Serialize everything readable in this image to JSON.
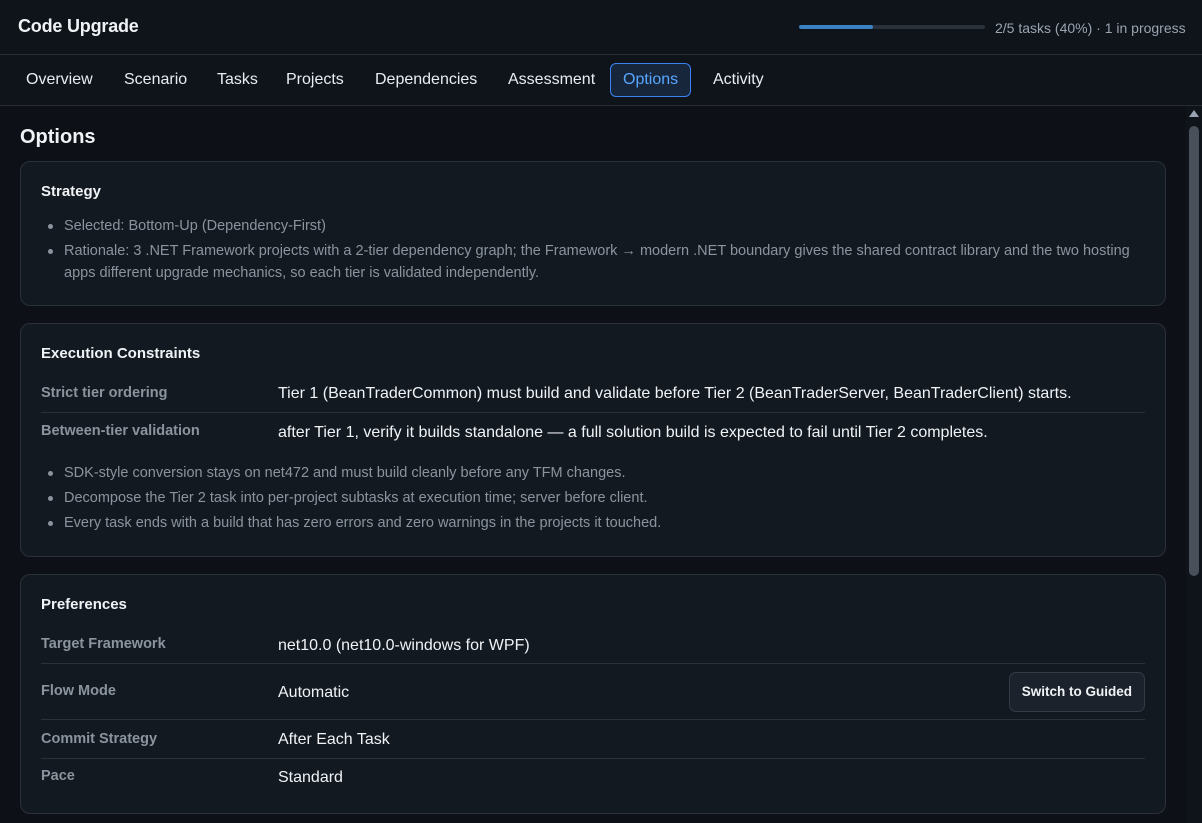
{
  "app": {
    "title": "Code Upgrade"
  },
  "progress": {
    "fraction": 0.4,
    "label": "2/5 tasks (40%) · 1 in progress"
  },
  "tabs": [
    {
      "label": "Overview",
      "active": false
    },
    {
      "label": "Scenario",
      "active": false
    },
    {
      "label": "Tasks",
      "active": false
    },
    {
      "label": "Projects",
      "active": false
    },
    {
      "label": "Dependencies",
      "active": false
    },
    {
      "label": "Assessment",
      "active": false
    },
    {
      "label": "Options",
      "active": true
    },
    {
      "label": "Activity",
      "active": false
    }
  ],
  "page": {
    "title": "Options"
  },
  "strategy": {
    "title": "Strategy",
    "items": [
      "Selected: Bottom-Up (Dependency-First)",
      "Rationale: 3 .NET Framework projects with a 2-tier dependency graph; the Framework → modern .NET boundary gives the shared contract library and the two hosting apps different upgrade mechanics, so each tier is validated independently."
    ]
  },
  "constraints": {
    "title": "Execution Constraints",
    "rows": [
      {
        "label": "Strict tier ordering",
        "value": "Tier 1 (BeanTraderCommon) must build and validate before Tier 2 (BeanTraderServer, BeanTraderClient) starts."
      },
      {
        "label": "Between-tier validation",
        "value": "after Tier 1, verify it builds standalone — a full solution build is expected to fail until Tier 2 completes."
      }
    ],
    "items": [
      "SDK-style conversion stays on net472 and must build cleanly before any TFM changes.",
      "Decompose the Tier 2 task into per-project subtasks at execution time; server before client.",
      "Every task ends with a build that has zero errors and zero warnings in the projects it touched."
    ]
  },
  "preferences": {
    "title": "Preferences",
    "rows": [
      {
        "label": "Target Framework",
        "value": "net10.0 (net10.0-windows for WPF)"
      },
      {
        "label": "Flow Mode",
        "value": "Automatic",
        "button": "Switch to Guided"
      },
      {
        "label": "Commit Strategy",
        "value": "After Each Task"
      },
      {
        "label": "Pace",
        "value": "Standard"
      }
    ]
  }
}
